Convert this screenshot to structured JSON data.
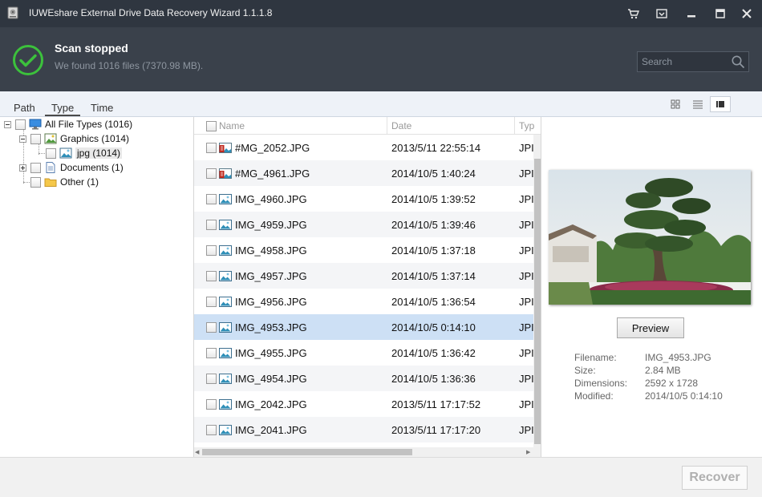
{
  "window": {
    "title": "IUWEshare External Drive Data Recovery Wizard 1.1.1.8",
    "icons": [
      "app-icon",
      "cart-icon",
      "register-icon",
      "minimize-icon",
      "maximize-icon",
      "close-icon"
    ]
  },
  "status": {
    "title": "Scan stopped",
    "subtitle": "We found 1016 files (7370.98 MB).",
    "icon": "checkmark-icon",
    "accent": "#3cc13c"
  },
  "search": {
    "placeholder": "Search",
    "value": ""
  },
  "tabs": [
    {
      "label": "Path",
      "active": false
    },
    {
      "label": "Type",
      "active": true
    },
    {
      "label": "Time",
      "active": false
    }
  ],
  "view_modes": [
    "grid-view-icon",
    "list-view-icon",
    "preview-view-icon"
  ],
  "tree": {
    "root": {
      "label": "All File Types (1016)",
      "icon": "computer-icon"
    },
    "items": [
      {
        "label": "Graphics (1014)",
        "icon": "image-icon"
      },
      {
        "label": "jpg (1014)",
        "icon": "image-icon"
      },
      {
        "label": "Documents (1)",
        "icon": "document-icon"
      },
      {
        "label": "Other (1)",
        "icon": "folder-icon"
      }
    ]
  },
  "columns": {
    "name": "Name",
    "date": "Date",
    "type": "Typ"
  },
  "files": [
    {
      "name": "#MG_2052.JPG",
      "date": "2013/5/11 22:55:14",
      "type": "JPI",
      "deleted": true
    },
    {
      "name": "#MG_4961.JPG",
      "date": "2014/10/5 1:40:24",
      "type": "JPI",
      "deleted": true
    },
    {
      "name": "IMG_4960.JPG",
      "date": "2014/10/5 1:39:52",
      "type": "JPI",
      "deleted": false
    },
    {
      "name": "IMG_4959.JPG",
      "date": "2014/10/5 1:39:46",
      "type": "JPI",
      "deleted": false
    },
    {
      "name": "IMG_4958.JPG",
      "date": "2014/10/5 1:37:18",
      "type": "JPI",
      "deleted": false
    },
    {
      "name": "IMG_4957.JPG",
      "date": "2014/10/5 1:37:14",
      "type": "JPI",
      "deleted": false
    },
    {
      "name": "IMG_4956.JPG",
      "date": "2014/10/5 1:36:54",
      "type": "JPI",
      "deleted": false
    },
    {
      "name": "IMG_4953.JPG",
      "date": "2014/10/5 0:14:10",
      "type": "JPI",
      "deleted": false,
      "selected": true
    },
    {
      "name": "IMG_4955.JPG",
      "date": "2014/10/5 1:36:42",
      "type": "JPI",
      "deleted": false
    },
    {
      "name": "IMG_4954.JPG",
      "date": "2014/10/5 1:36:36",
      "type": "JPI",
      "deleted": false
    },
    {
      "name": "IMG_2042.JPG",
      "date": "2013/5/11 17:17:52",
      "type": "JPI",
      "deleted": false
    },
    {
      "name": "IMG_2041.JPG",
      "date": "2013/5/11 17:17:20",
      "type": "JPI",
      "deleted": false
    }
  ],
  "preview": {
    "button": "Preview",
    "fields": [
      {
        "label": "Filename:",
        "value": "IMG_4953.JPG"
      },
      {
        "label": "Size:",
        "value": "2.84 MB"
      },
      {
        "label": "Dimensions:",
        "value": "2592 x 1728"
      },
      {
        "label": "Modified:",
        "value": "2014/10/5 0:14:10"
      }
    ]
  },
  "footer": {
    "recover": "Recover"
  },
  "colors": {
    "titlebar": "#2f3640",
    "header": "#3a414b",
    "selected_row": "#cde0f5",
    "tabbar": "#eef2f8"
  }
}
